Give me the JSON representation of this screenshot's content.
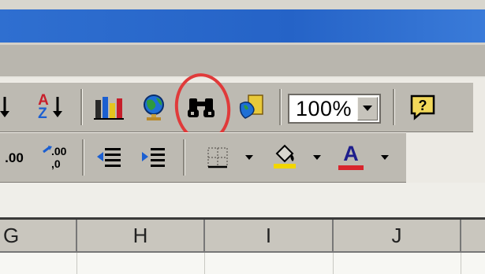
{
  "colors": {
    "titlebar": "#2563c7",
    "toolbar": "#bdbab2",
    "highlight": "#e03a3a",
    "fill_yellow": "#f2d600",
    "font_red": "#d8242c"
  },
  "standard_toolbar": {
    "sort_desc_label": "ZA",
    "zoom_value": "100%"
  },
  "formatting_toolbar": {
    "increase_decimal_label": ".00",
    "decrease_decimal_label": ".0",
    "font_color_letter": "A"
  },
  "columns": [
    "G",
    "H",
    "I",
    "J"
  ]
}
